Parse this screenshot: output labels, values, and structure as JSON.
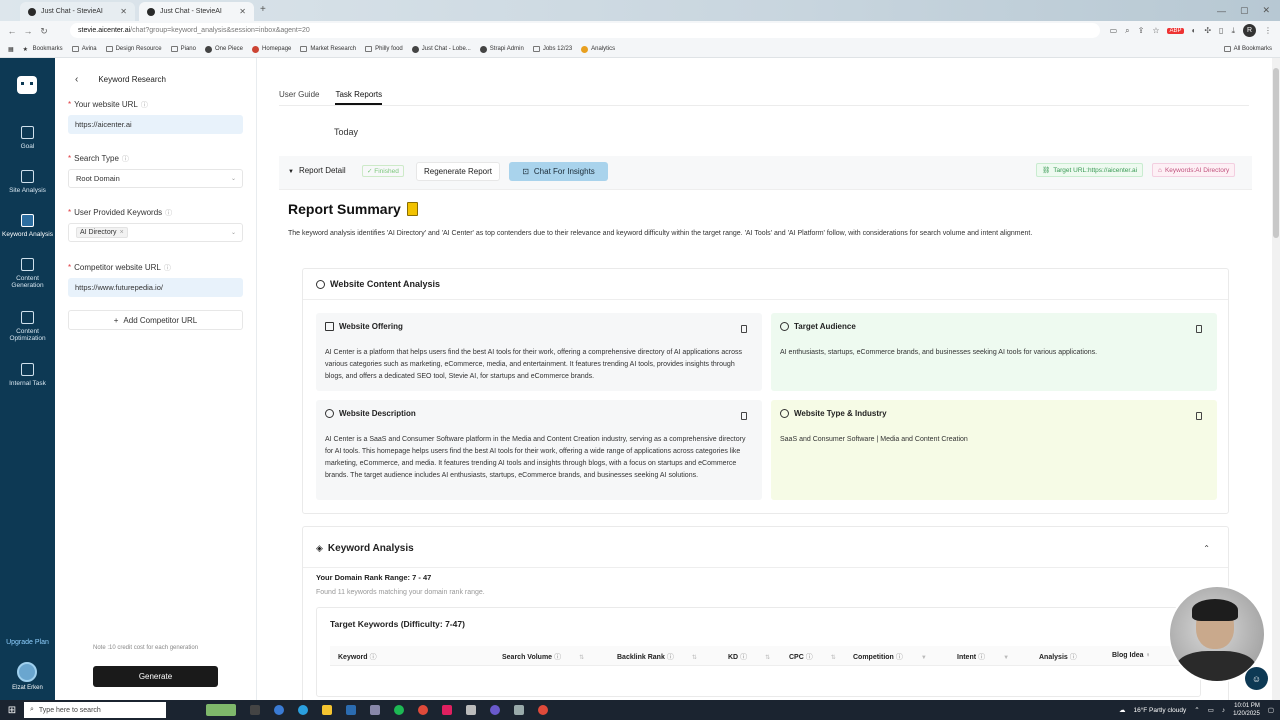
{
  "browser": {
    "tabs": [
      {
        "title": "Just Chat - StevieAI",
        "active": false
      },
      {
        "title": "Just Chat - StevieAI",
        "active": true
      }
    ],
    "url_domain": "stevie.aicenter.ai",
    "url_path": "/chat?group=keyword_analysis&session=inbox&agent=20",
    "bookmarks": [
      "Bookmarks",
      "Avina",
      "Design Resource",
      "Piano",
      "One Piece",
      "Homepage",
      "Market Research",
      "Philly food",
      "Just Chat - Lobe...",
      "Strapi Admin",
      "Jobs 12/23",
      "Analytics"
    ],
    "all_bookmarks": "All Bookmarks"
  },
  "leftnav": {
    "items": [
      {
        "label": "Goal",
        "icon": "goal-icon"
      },
      {
        "label": "Site Analysis",
        "icon": "site-analysis-icon"
      },
      {
        "label": "Keyword Analysis",
        "icon": "keyword-analysis-icon",
        "active": true
      },
      {
        "label": "Content Generation",
        "icon": "content-generation-icon"
      },
      {
        "label": "Content Optimization",
        "icon": "content-optimization-icon"
      },
      {
        "label": "Internal Task",
        "icon": "internal-task-icon"
      }
    ],
    "upgrade": "Upgrade Plan",
    "user_name": "Elzat Erken"
  },
  "panel": {
    "title": "Keyword Research",
    "website_url_label": "Your website URL",
    "website_url_value": "https://aicenter.ai",
    "search_type_label": "Search Type",
    "search_type_value": "Root Domain",
    "user_keywords_label": "User Provided Keywords",
    "user_keyword_tag": "AI Directory",
    "competitor_label": "Competitor website URL",
    "competitor_value": "https://www.futurepedia.io/",
    "add_competitor": "Add Competitor URL",
    "note": "Note :10 credit cost for each generation",
    "generate": "Generate"
  },
  "main": {
    "tabs": [
      "User Guide",
      "Task Reports"
    ],
    "active_tab": "Task Reports",
    "today": "Today",
    "report_detail": "Report Detail",
    "status": "Finished",
    "regenerate": "Regenerate Report",
    "chat_insights": "Chat For Insights",
    "target_url": "Target URL:https://aicenter.ai",
    "keywords_chip": "Keywords:AI Directory",
    "summary_title": "Report Summary",
    "summary_text": "The keyword analysis identifies 'AI Directory' and 'AI Center' as top contenders due to their relevance and keyword difficulty within the target range. 'AI Tools' and 'AI Platform' follow, with considerations for search volume and intent alignment.",
    "content_analysis": {
      "title": "Website Content Analysis",
      "offering_title": "Website Offering",
      "offering_body": "AI Center is a platform that helps users find the best AI tools for their work, offering a comprehensive directory of AI applications across various categories such as marketing, eCommerce, media, and entertainment. It features trending AI tools, provides insights through blogs, and offers a dedicated SEO tool, Stevie AI, for startups and eCommerce brands.",
      "audience_title": "Target Audience",
      "audience_body": "AI enthusiasts, startups, eCommerce brands, and businesses seeking AI tools for various applications.",
      "description_title": "Website Description",
      "description_body": "AI Center is a SaaS and Consumer Software platform in the Media and Content Creation industry, serving as a comprehensive directory for AI tools. This homepage helps users find the best AI tools for their work, offering a wide range of applications across categories like marketing, eCommerce, and media. It features trending AI tools and insights through blogs, with a focus on startups and eCommerce brands. The target audience includes AI enthusiasts, startups, eCommerce brands, and businesses seeking AI solutions.",
      "type_title": "Website Type & Industry",
      "type_body": "SaaS and Consumer Software | Media and Content Creation"
    },
    "keyword_analysis": {
      "title": "Keyword Analysis",
      "range": "Your Domain Rank Range: 7 - 47",
      "found": "Found 11 keywords matching your domain rank range.",
      "target_title": "Target Keywords (Difficulty: 7-47)",
      "columns": [
        "Keyword",
        "Search Volume",
        "Backlink Rank",
        "KD",
        "CPC",
        "Competition",
        "Intent",
        "Analysis",
        "Blog Idea"
      ]
    }
  },
  "taskbar": {
    "search_placeholder": "Type here to search",
    "weather": "16°F  Partly cloudy",
    "time": "10:01 PM",
    "date": "1/20/2025"
  }
}
